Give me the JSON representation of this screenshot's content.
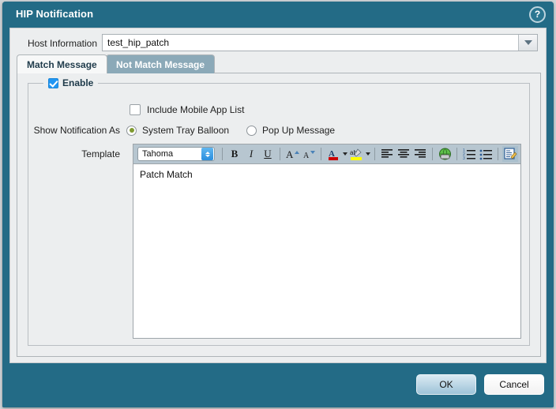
{
  "window": {
    "title": "HIP Notification",
    "help_icon": "help-circle-icon",
    "accent_color": "#236b86",
    "panel_color": "#eceeef"
  },
  "host_information": {
    "label": "Host Information",
    "value": "test_hip_patch",
    "placeholder": "",
    "dropdown_icon": "caret-down-icon"
  },
  "tabs": [
    {
      "label": "Match Message",
      "active": true
    },
    {
      "label": "Not Match Message",
      "active": false
    }
  ],
  "fieldset": {
    "legend_label": "Enable",
    "legend_checked": true
  },
  "options": {
    "include_mobile_app_list": {
      "label": "Include Mobile App List",
      "checked": false
    },
    "show_notification_as": {
      "label": "Show Notification As",
      "choices": [
        {
          "label": "System Tray Balloon",
          "selected": true
        },
        {
          "label": "Pop Up Message",
          "selected": false
        }
      ],
      "selected_dot_color": "#7f9a30"
    }
  },
  "template": {
    "label": "Template",
    "font_family_value": "Tahoma",
    "body_text": "Patch Match",
    "toolbar": [
      {
        "name": "font-family-select",
        "label": "Tahoma"
      },
      {
        "name": "bold-button",
        "label": "B"
      },
      {
        "name": "italic-button",
        "label": "I"
      },
      {
        "name": "underline-button",
        "label": "U"
      },
      {
        "name": "increase-font-size-button",
        "label": "A"
      },
      {
        "name": "decrease-font-size-button",
        "label": "A"
      },
      {
        "name": "text-color-button",
        "label": "A",
        "color": "#cc0000"
      },
      {
        "name": "highlight-color-button",
        "label": "ab",
        "color": "#ffff00"
      },
      {
        "name": "align-left-button",
        "label": ""
      },
      {
        "name": "align-center-button",
        "label": ""
      },
      {
        "name": "align-right-button",
        "label": ""
      },
      {
        "name": "insert-link-globe-button",
        "label": ""
      },
      {
        "name": "numbered-list-button",
        "label": ""
      },
      {
        "name": "bulleted-list-button",
        "label": ""
      },
      {
        "name": "edit-source-button",
        "label": ""
      }
    ]
  },
  "footer": {
    "ok_label": "OK",
    "cancel_label": "Cancel"
  }
}
